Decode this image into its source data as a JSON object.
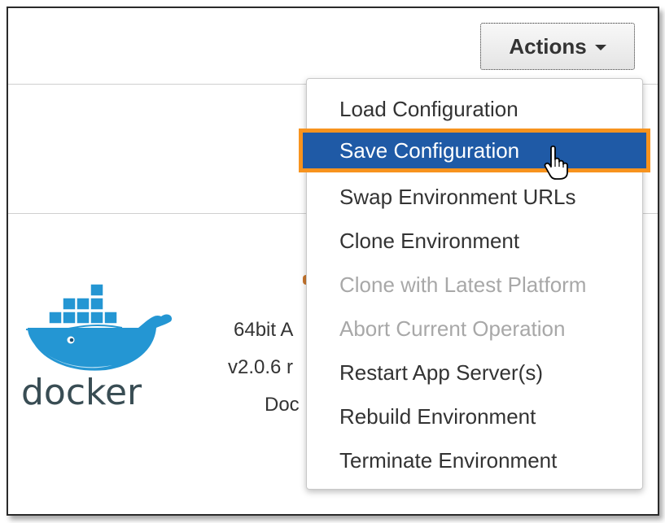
{
  "actions_button": {
    "label": "Actions"
  },
  "app_panel": {
    "logo_text": "docker",
    "lines": [
      "64bit A",
      "v2.0.6 r",
      "Doc"
    ]
  },
  "actions_menu": {
    "items": [
      {
        "label": "Load Configuration",
        "state": "enabled"
      },
      {
        "label": "Save Configuration",
        "state": "highlighted"
      },
      {
        "label": "Swap Environment URLs",
        "state": "enabled"
      },
      {
        "label": "Clone Environment",
        "state": "enabled"
      },
      {
        "label": "Clone with Latest Platform",
        "state": "disabled"
      },
      {
        "label": "Abort Current Operation",
        "state": "disabled"
      },
      {
        "label": "Restart App Server(s)",
        "state": "enabled"
      },
      {
        "label": "Rebuild Environment",
        "state": "enabled"
      },
      {
        "label": "Terminate Environment",
        "state": "enabled"
      }
    ]
  },
  "colors": {
    "highlight_bg": "#1f5aa6",
    "highlight_border": "#f7931e",
    "docker_blue": "#2496d3",
    "disabled_text": "#a8a8a8"
  }
}
